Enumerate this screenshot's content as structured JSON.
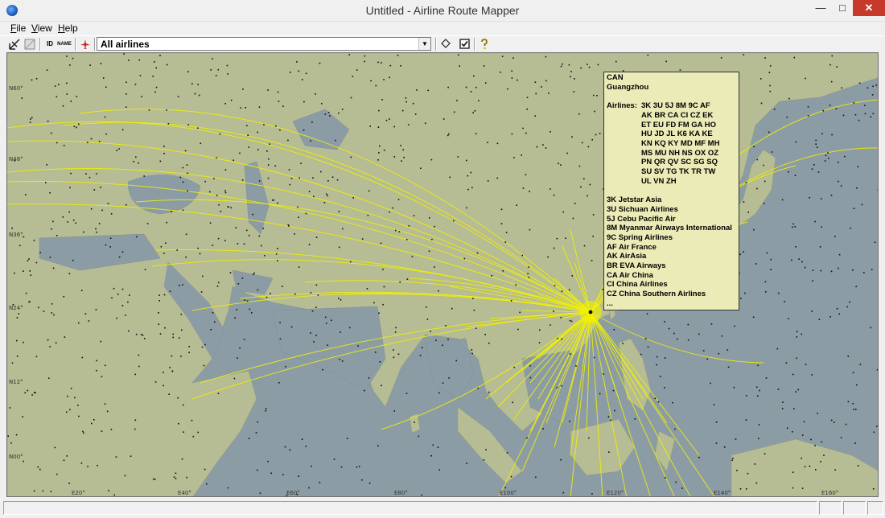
{
  "window": {
    "title": "Untitled - Airline Route Mapper",
    "minimize_glyph": "—",
    "maximize_glyph": "□",
    "close_glyph": "✕"
  },
  "menu": {
    "file": {
      "hotkey": "F",
      "rest": "ile"
    },
    "view": {
      "hotkey": "V",
      "rest": "iew"
    },
    "help": {
      "hotkey": "H",
      "rest": "elp"
    }
  },
  "toolbar": {
    "id_label": "ID",
    "name_label": "NAME",
    "airline_selected": "All airlines",
    "icons": [
      "map-style-icon",
      "map-image-icon",
      "id-icon",
      "name-icon",
      "airplane-icon",
      "diamond-icon",
      "checkbox-icon",
      "help-icon"
    ]
  },
  "map": {
    "lat_labels": [
      "N60°",
      "N48°",
      "N36°",
      "N24°",
      "N12°",
      "N00°"
    ],
    "lon_labels": [
      "E20°",
      "E40°",
      "E60°",
      "E80°",
      "E100°",
      "E120°",
      "E140°",
      "E160°"
    ],
    "colors": {
      "ocean": "#8c9ca5",
      "land": "#b6bc93",
      "route": "#f2f200",
      "airport": "#111111"
    }
  },
  "info": {
    "code": "CAN",
    "city": "Guangzhou",
    "airlines_label": "Airlines:",
    "code_rows": [
      "3K 3U 5J 8M 9C AF",
      "AK BR CA CI CZ EK",
      "ET EU FD FM GA HO",
      "HU JD JL K6 KA KE",
      "KN KQ KY MD MF MH",
      "MS MU NH NS OX OZ",
      "PN QR QV SC SG SQ",
      "SU SV TG TK TR TW",
      "UL VN ZH"
    ],
    "details": [
      "3K  Jetstar Asia",
      "3U  Sichuan Airlines",
      "5J  Cebu Pacific Air",
      "8M  Myanmar Airways International",
      "9C  Spring Airlines",
      "AF  Air France",
      "AK  AirAsia",
      "BR  EVA Airways",
      "CA  Air China",
      "CI  China Airlines",
      "CZ  China Southern Airlines",
      "..."
    ]
  }
}
